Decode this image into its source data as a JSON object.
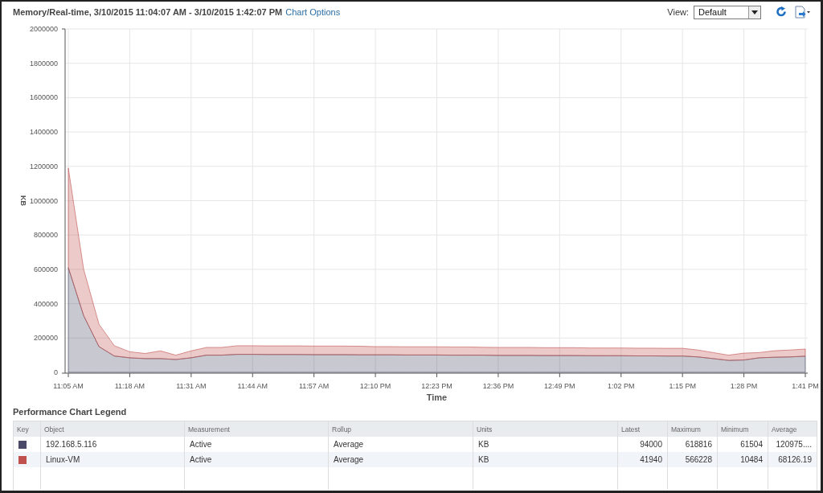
{
  "header": {
    "title": "Memory/Real-time, 3/10/2015 11:04:07 AM - 3/10/2015 1:42:07 PM",
    "link": "Chart Options",
    "view_label": "View:",
    "view_value": "Default"
  },
  "chart_data": {
    "type": "area",
    "stacked": true,
    "grid": true,
    "xlabel": "Time",
    "ylabel": "KB",
    "ylim": [
      0,
      2000000
    ],
    "categories": [
      "11:05 AM",
      null,
      null,
      null,
      "11:18 AM",
      null,
      null,
      null,
      "11:31 AM",
      null,
      null,
      null,
      "11:44 AM",
      null,
      null,
      null,
      "11:57 AM",
      null,
      null,
      null,
      "12:10 PM",
      null,
      null,
      null,
      "12:23 PM",
      null,
      null,
      null,
      "12:36 PM",
      null,
      null,
      null,
      "12:49 PM",
      null,
      null,
      null,
      "1:02 PM",
      null,
      null,
      null,
      "1:15 PM",
      null,
      null,
      null,
      "1:28 PM",
      null,
      null,
      null,
      "1:41 PM"
    ],
    "yticks": [
      0,
      200000,
      400000,
      600000,
      800000,
      1000000,
      1200000,
      1400000,
      1600000,
      1800000,
      2000000
    ],
    "series": [
      {
        "name": "192.168.5.116",
        "color": "#4a4a68",
        "values": [
          610000,
          330000,
          150000,
          95000,
          85000,
          80000,
          80000,
          75000,
          85000,
          100000,
          100000,
          105000,
          105000,
          104000,
          104000,
          104000,
          103000,
          103000,
          103000,
          102000,
          102000,
          102000,
          101000,
          101000,
          101000,
          100000,
          100000,
          100000,
          99000,
          99000,
          99000,
          98000,
          98000,
          98000,
          97000,
          97000,
          97000,
          96000,
          96000,
          95000,
          95000,
          90000,
          80000,
          70000,
          72000,
          85000,
          88000,
          90000,
          94000
        ]
      },
      {
        "name": "Linux-VM",
        "color": "#c0504d",
        "values": [
          580000,
          270000,
          130000,
          60000,
          35000,
          30000,
          45000,
          25000,
          40000,
          45000,
          45000,
          50000,
          50000,
          50000,
          50000,
          50000,
          50000,
          50000,
          50000,
          50000,
          48000,
          48000,
          48000,
          48000,
          48000,
          48000,
          48000,
          46000,
          46000,
          46000,
          46000,
          46000,
          46000,
          46000,
          45000,
          45000,
          45000,
          45000,
          45000,
          45000,
          45000,
          40000,
          35000,
          30000,
          40000,
          30000,
          38000,
          40000,
          42000
        ]
      }
    ]
  },
  "legend": {
    "title": "Performance Chart Legend",
    "columns": [
      "Key",
      "Object",
      "Measurement",
      "Rollup",
      "Units",
      "Latest",
      "Maximum",
      "Minimum",
      "Average"
    ],
    "rows": [
      {
        "color": "#4a4a68",
        "measurement": "Active",
        "rollup": "Average",
        "units": "KB",
        "latest": "94000",
        "maximum": "618816",
        "minimum": "61504",
        "average": "120975...."
      },
      {
        "color": "#c0504d",
        "measurement": "Active",
        "rollup": "Average",
        "units": "KB",
        "latest": "41940",
        "maximum": "566228",
        "minimum": "10484",
        "average": "68126.19"
      }
    ]
  }
}
